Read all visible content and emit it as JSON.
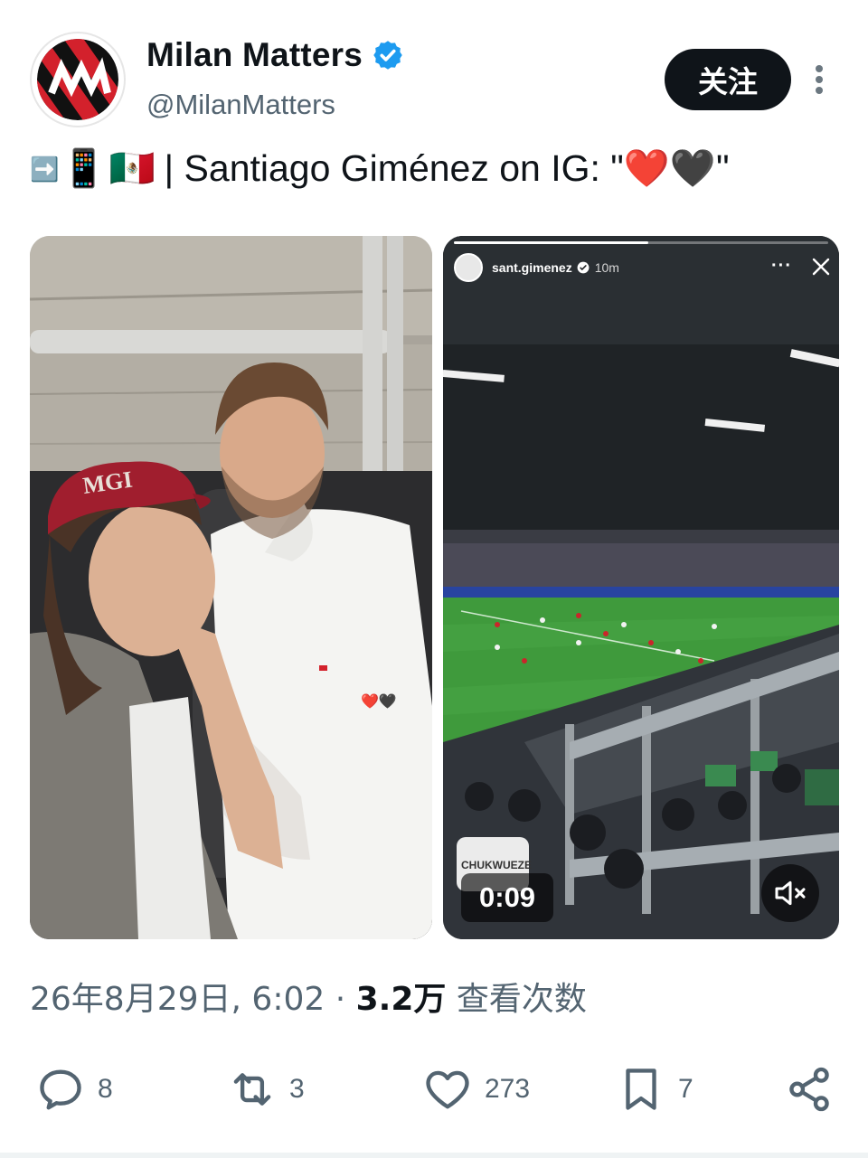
{
  "account": {
    "display_name": "Milan Matters",
    "handle": "@MilanMatters",
    "follow_label": "关注"
  },
  "tweet": {
    "emojis": [
      "➡️",
      "📱",
      "🇲🇽"
    ],
    "text": "| Santiago Giménez on IG: \"❤️🖤\""
  },
  "media": {
    "left_heart_emojis": "❤️🖤",
    "story": {
      "username": "sant.gimenez",
      "time": "10m",
      "more": "···",
      "duration": "0:09",
      "jersey_text": "CHUKWUEZE"
    }
  },
  "meta": {
    "date": "26年8月29日, 6:02",
    "separator": "·",
    "views_count": "3.2万",
    "views_label": "查看次数"
  },
  "actions": {
    "replies": "8",
    "reposts": "3",
    "likes": "273",
    "bookmarks": "7"
  },
  "colors": {
    "verified_blue": "#1d9bf0",
    "milan_red": "#d3212c",
    "pitch_green": "#3f9a3c"
  }
}
